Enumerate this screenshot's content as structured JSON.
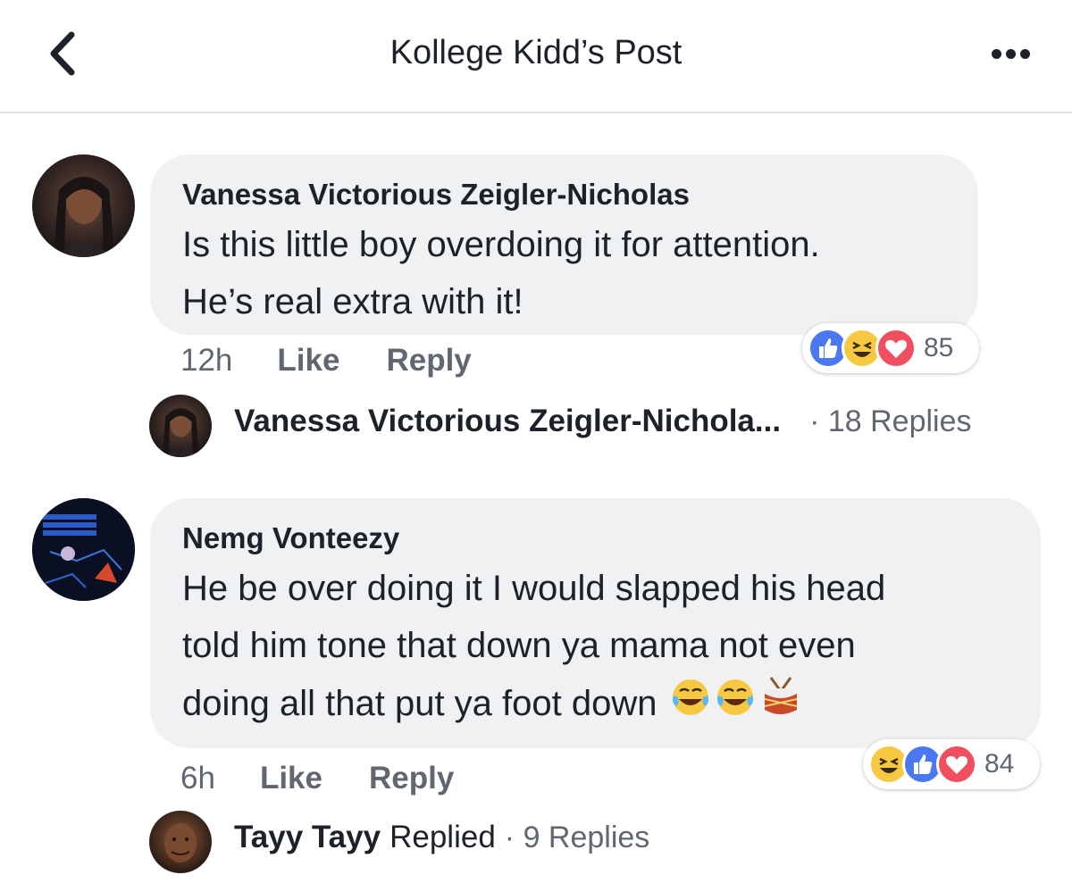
{
  "header": {
    "title": "Kollege Kidd’s Post"
  },
  "comments": [
    {
      "author": "Vanessa Victorious Zeigler-Nicholas",
      "lines": [
        "Is this little boy overdoing it for attention.",
        "He’s real extra with it!"
      ],
      "time": "12h",
      "like_label": "Like",
      "reply_label": "Reply",
      "reactions": [
        "like",
        "haha",
        "love"
      ],
      "reaction_count": "85",
      "reply_summary": {
        "name": "Vanessa Victorious Zeigler-Nichola...",
        "verb": "",
        "count": "· 18 Replies"
      }
    },
    {
      "author": "Nemg Vonteezy",
      "lines": [
        "He be over doing it I would slapped his head",
        "told him tone that down ya mama not even",
        "doing all that put ya foot down"
      ],
      "emojis": [
        "tears-of-joy",
        "tears-of-joy",
        "drum"
      ],
      "time": "6h",
      "like_label": "Like",
      "reply_label": "Reply",
      "reactions": [
        "haha",
        "like",
        "love"
      ],
      "reaction_count": "84",
      "reply_summary": {
        "name": "Tayy Tayy",
        "verb": "Replied",
        "count": "· 9 Replies"
      }
    }
  ],
  "colors": {
    "bubble": "#f0f1f3",
    "text": "#1d2129",
    "secondary": "#606770",
    "like_blue": "#4a78f0",
    "haha_yellow": "#f7c942",
    "love_red": "#ef4f5f"
  }
}
